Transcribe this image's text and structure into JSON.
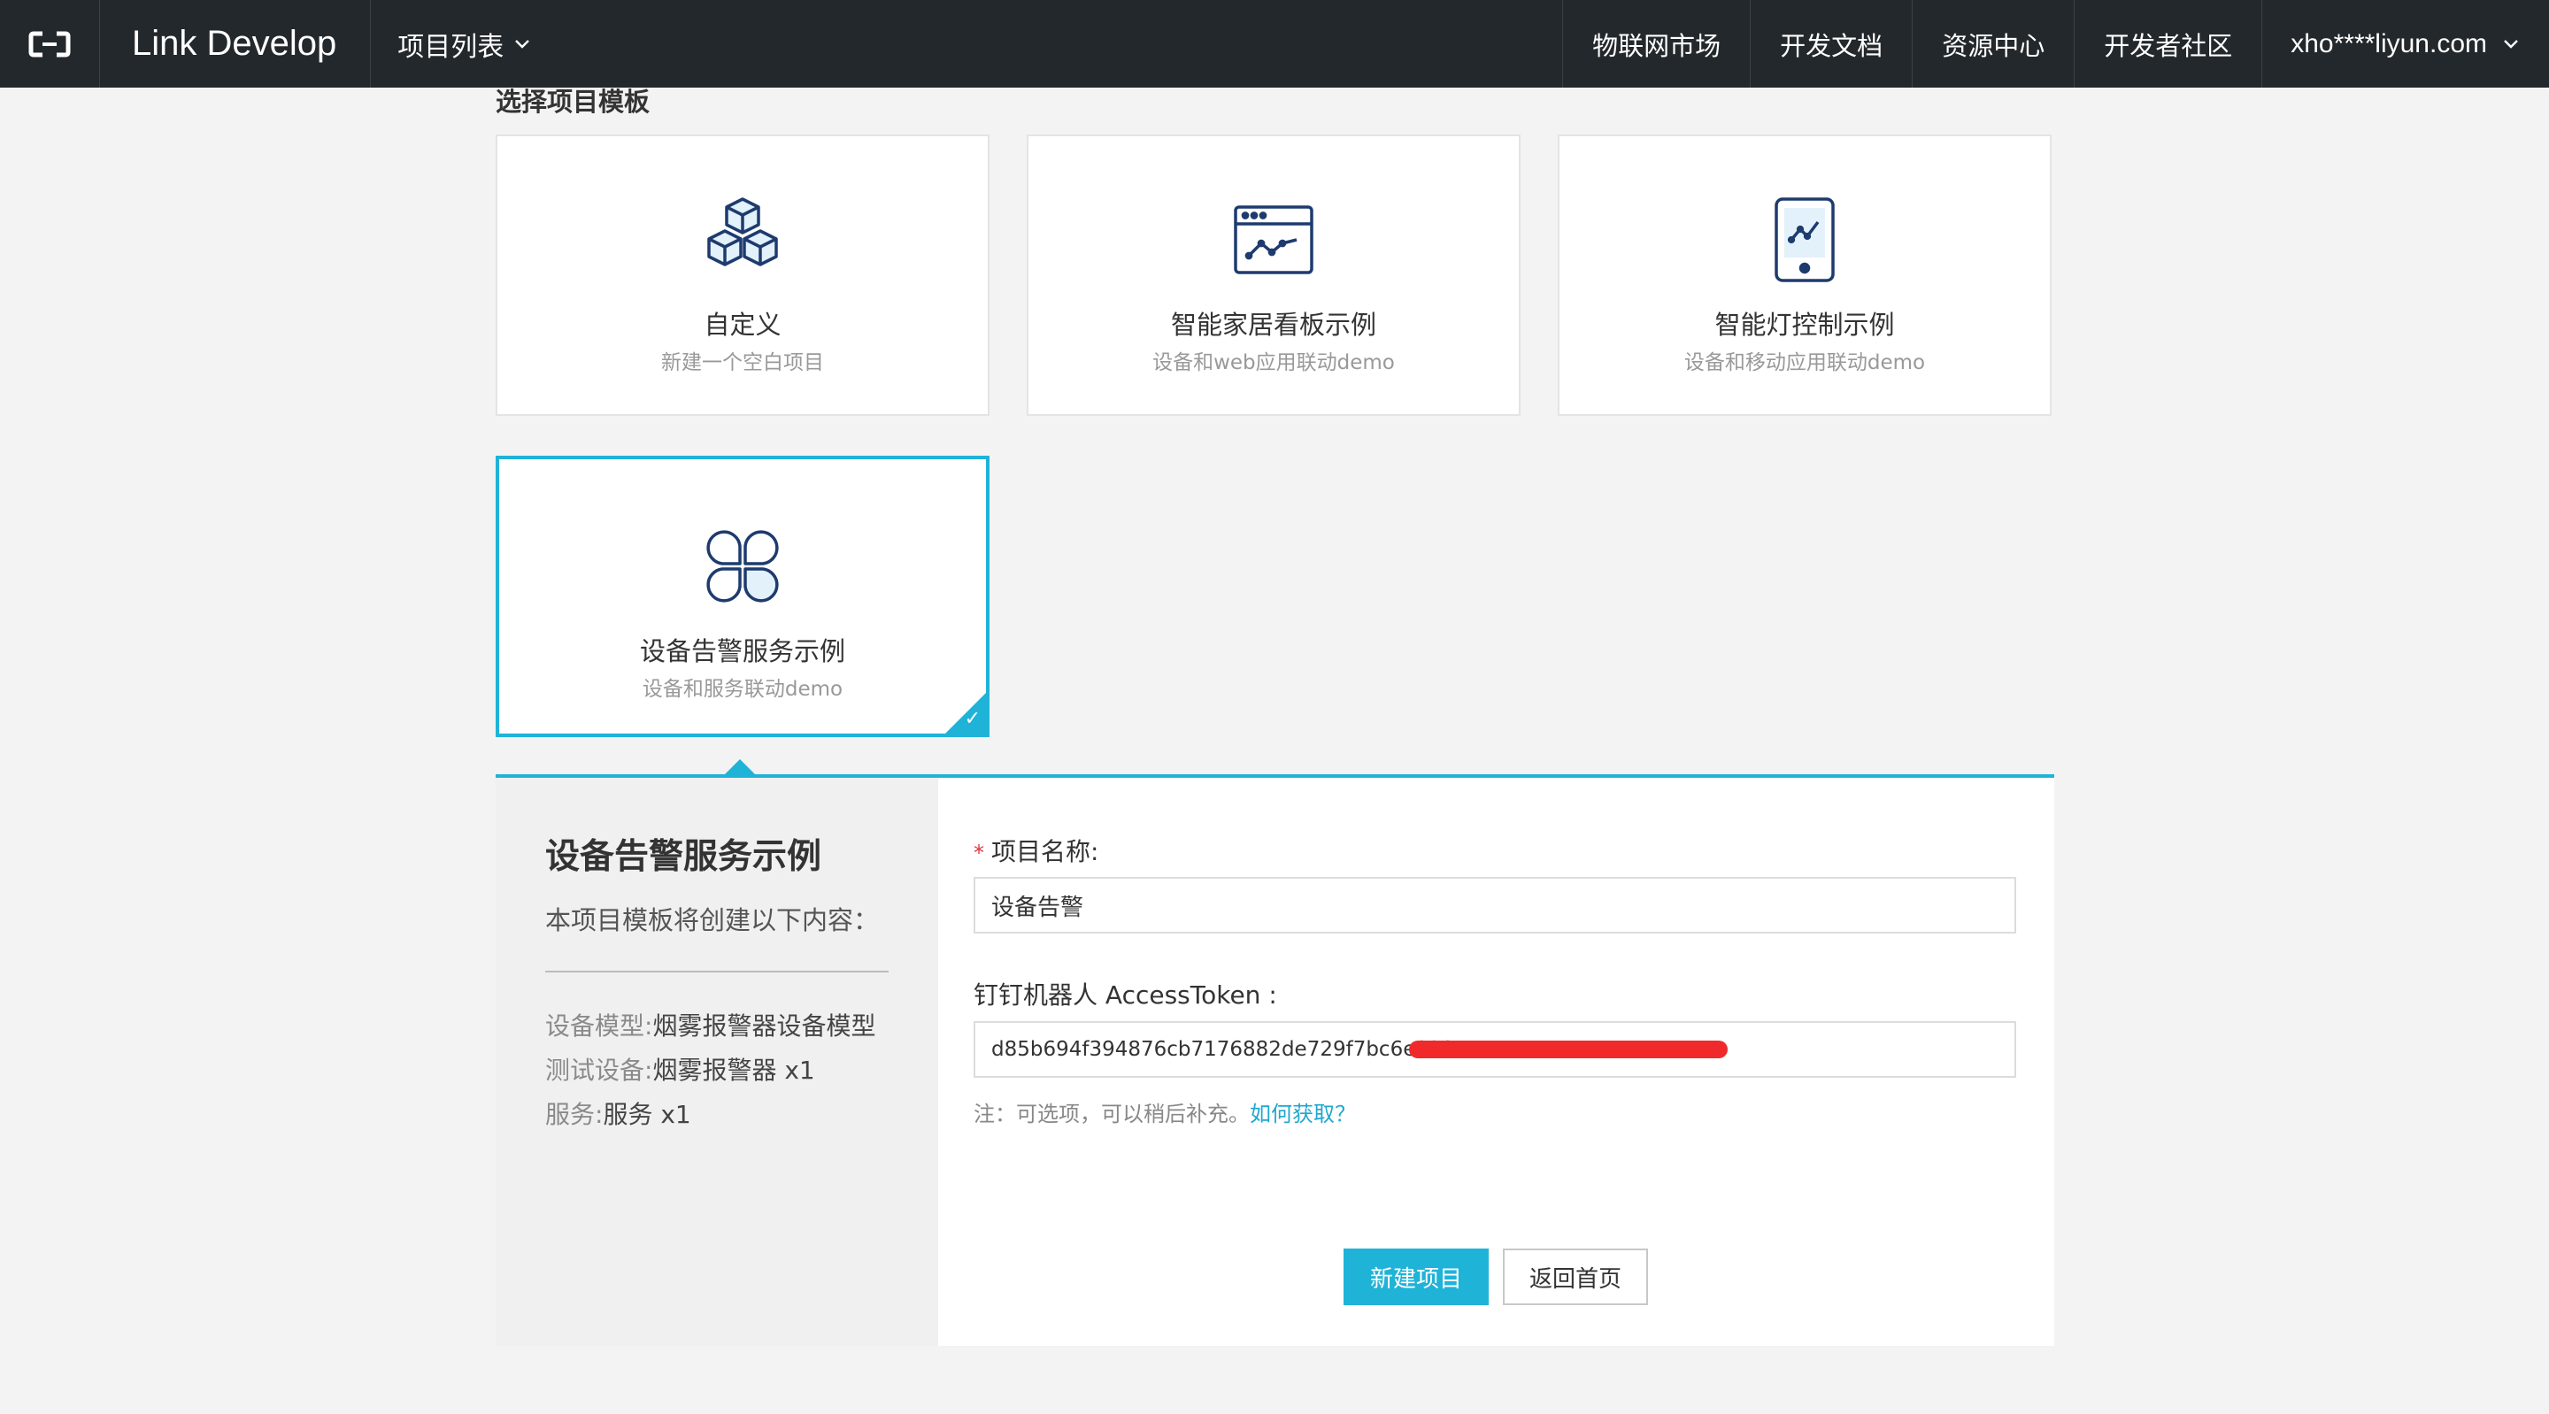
{
  "nav": {
    "brand": "Link Develop",
    "project_menu": "项目列表",
    "links": [
      "物联网市场",
      "开发文档",
      "资源中心",
      "开发者社区"
    ],
    "user": "xho****liyun.com"
  },
  "section": {
    "title": "选择项目模板"
  },
  "templates": [
    {
      "title": "自定义",
      "subtitle": "新建一个空白项目",
      "icon": "cubes-icon"
    },
    {
      "title": "智能家居看板示例",
      "subtitle": "设备和web应用联动demo",
      "icon": "dashboard-browser-icon"
    },
    {
      "title": "智能灯控制示例",
      "subtitle": "设备和移动应用联动demo",
      "icon": "mobile-chart-icon"
    },
    {
      "title": "设备告警服务示例",
      "subtitle": "设备和服务联动demo",
      "icon": "clover-icon"
    }
  ],
  "detail": {
    "title": "设备告警服务示例",
    "desc": "本项目模板将创建以下内容：",
    "items": [
      {
        "key": "设备模型:",
        "value": "烟雾报警器设备模型"
      },
      {
        "key": "测试设备:",
        "value": "烟雾报警器 x1"
      },
      {
        "key": "服务:",
        "value": "服务 x1"
      }
    ]
  },
  "form": {
    "name_label": "项目名称:",
    "name_required_mark": "*",
    "name_value": "设备告警",
    "token_label": "钉钉机器人 AccessToken :",
    "token_value": "d85b694f394876cb7176882de729f7bc6e329",
    "note_text": "注：可选项，可以稍后补充。",
    "note_link": "如何获取？",
    "submit_label": "新建项目",
    "back_label": "返回首页"
  },
  "colors": {
    "accent": "#1fb3d8",
    "topbar": "#23282c",
    "required": "#e0343b",
    "redaction": "#f02a2a"
  }
}
